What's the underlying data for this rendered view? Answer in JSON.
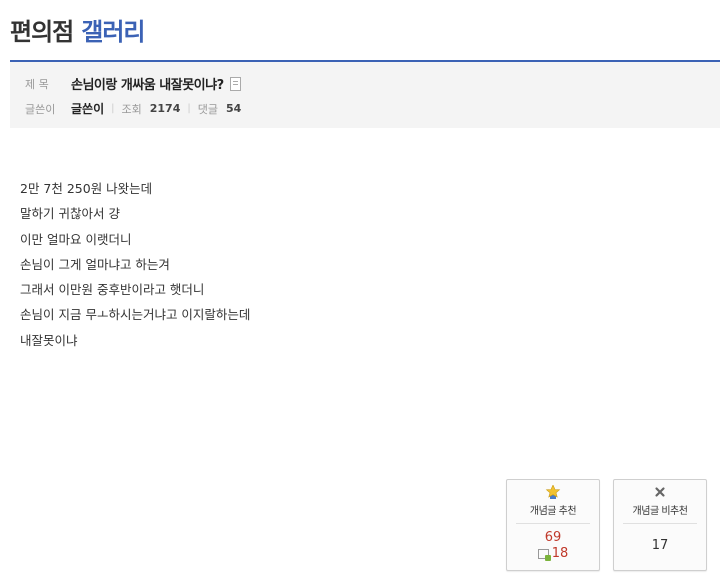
{
  "gallery": {
    "title_part1": "편의점",
    "title_part2": "갤러리"
  },
  "post": {
    "subject_label": "제 목",
    "subject": "손님이랑 개싸움 내잘못이냐?",
    "writer_label": "글쓴이",
    "writer": "글쓴이",
    "views_label": "조회",
    "views": "2174",
    "comments_label": "댓글",
    "comments": "54"
  },
  "content": {
    "lines": [
      "2만 7천 250원 나왓는데",
      "말하기 귀찮아서 걍",
      "이만 얼마요 이랫더니",
      "손님이 그게 얼마냐고 하는겨",
      "그래서 이만원 중후반이라고 햇더니",
      "손님이 지금 무ㅗ하시는거냐고 이지랄하는데",
      "내잘못이냐"
    ]
  },
  "vote": {
    "up_label": "개념글 추천",
    "up_count": "69",
    "fix_count": "18",
    "down_label": "개념글 비추천",
    "down_count": "17"
  },
  "colors": {
    "accent": "#3b62b5",
    "vote_up_count": "#c0392b"
  },
  "icons": {
    "up": "star-medal-icon",
    "down": "x-icon",
    "fixed": "fixed-user-icon",
    "doc": "document-icon"
  }
}
